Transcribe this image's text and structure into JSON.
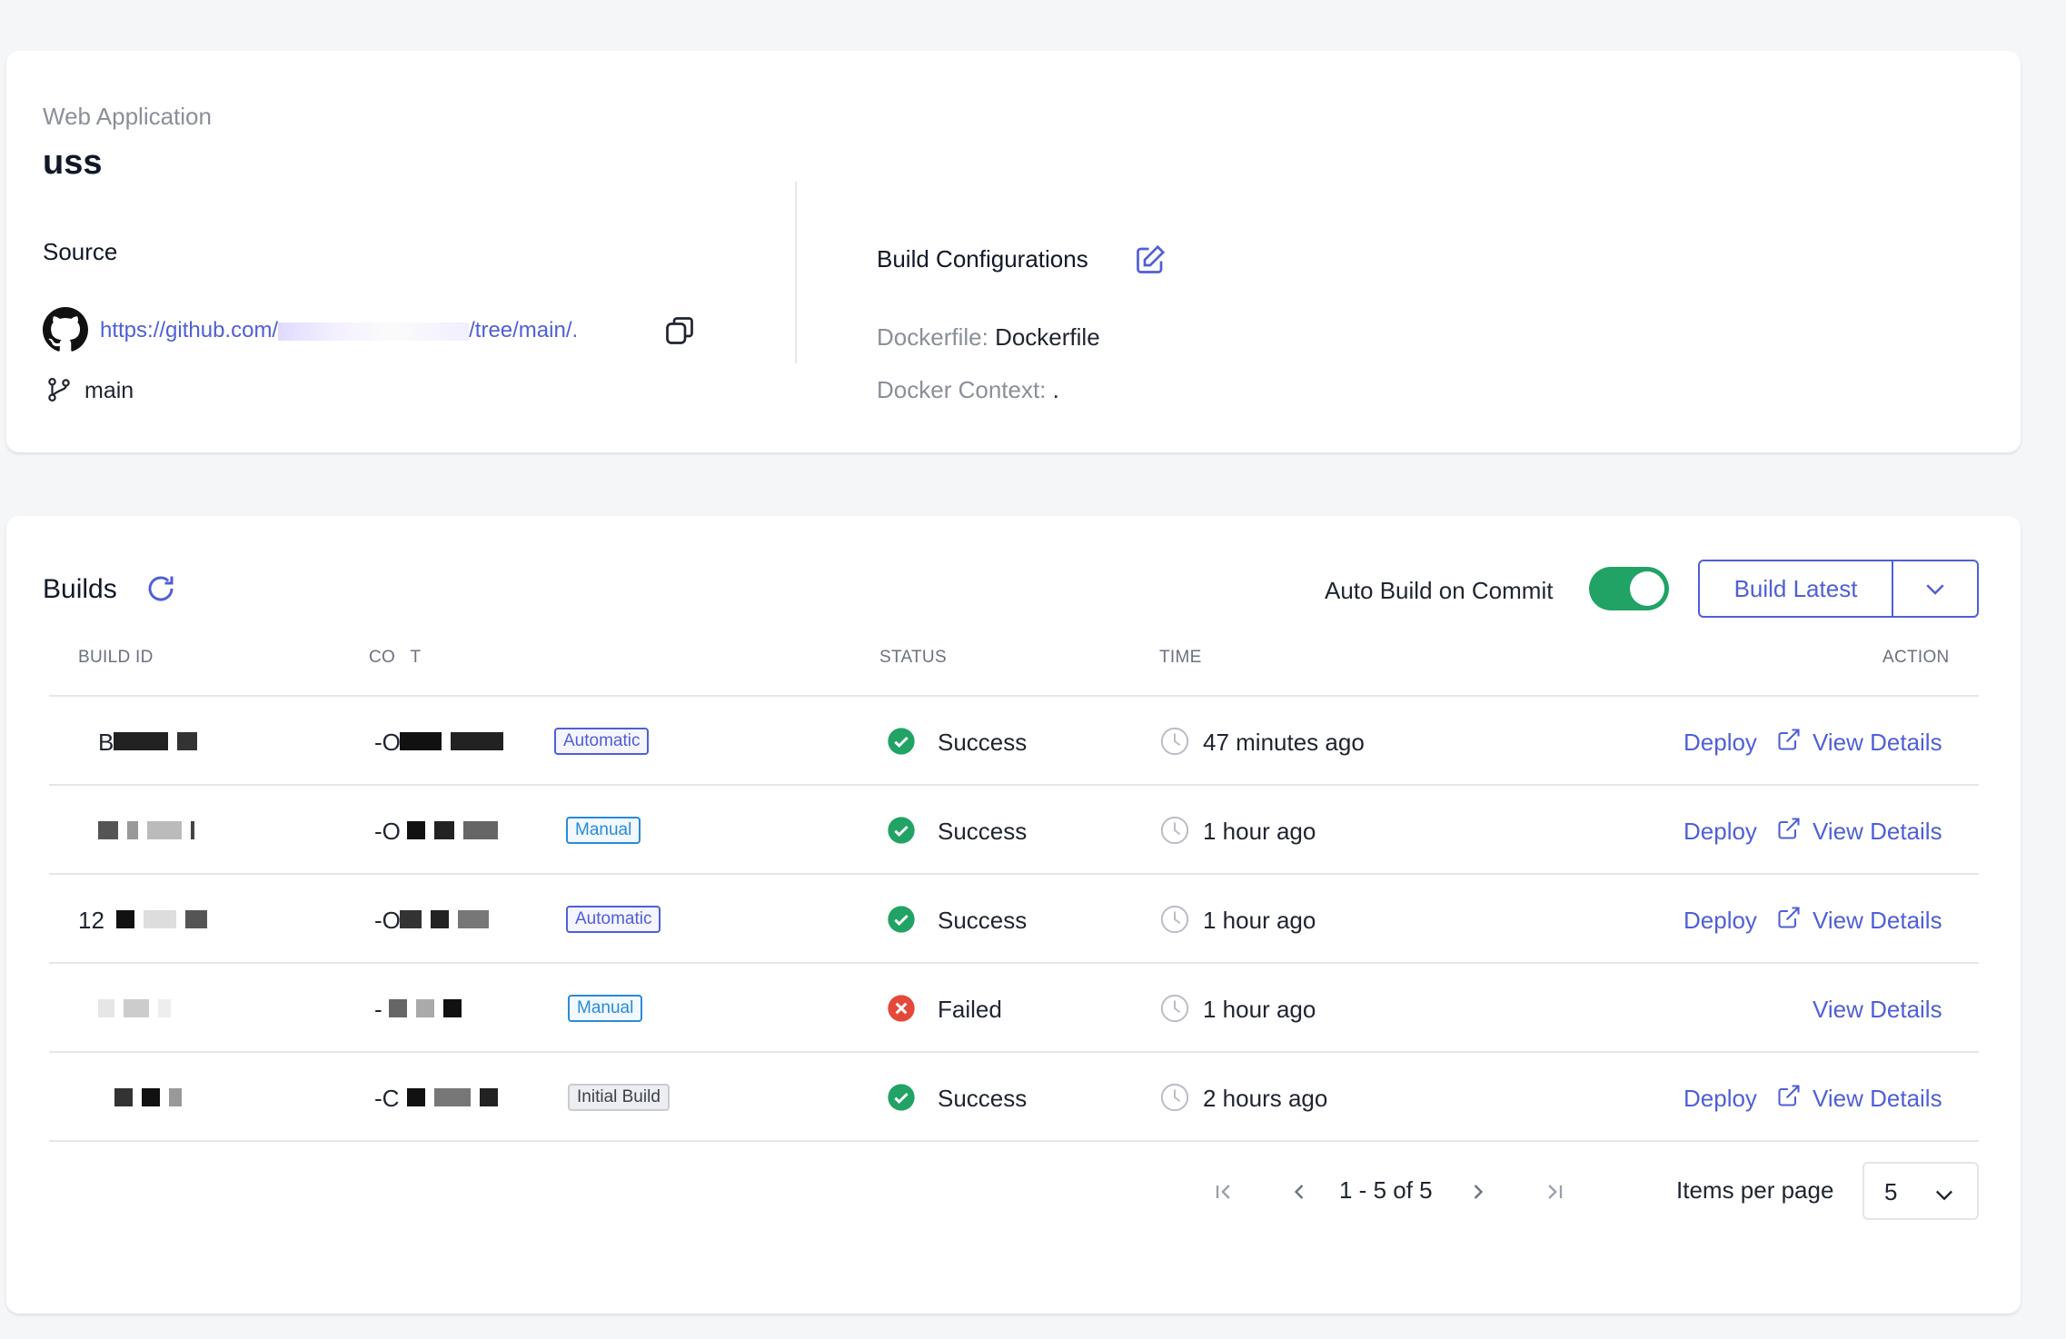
{
  "app": {
    "kind": "Web Application",
    "name": "uss"
  },
  "source": {
    "label": "Source",
    "repo_prefix": "https://github.com/",
    "repo_suffix": "/tree/main/.",
    "branch": "main"
  },
  "build_config": {
    "label": "Build Configurations",
    "dockerfile_key": "Dockerfile:",
    "dockerfile_value": "Dockerfile",
    "context_key": "Docker Context:",
    "context_value": "."
  },
  "builds": {
    "title": "Builds",
    "auto_build_label": "Auto Build on Commit",
    "auto_build_enabled": true,
    "build_latest_label": "Build Latest",
    "columns": {
      "build_id": "BUILD ID",
      "commit": "CO   T",
      "status": "STATUS",
      "time": "TIME",
      "action": "ACTION"
    },
    "rows": [
      {
        "build_id_visible": "B",
        "commit_visible": "-O",
        "trigger": "Automatic",
        "trigger_kind": "auto",
        "status": "Success",
        "time": "47 minutes ago",
        "deploy": "Deploy",
        "details": "View Details"
      },
      {
        "build_id_visible": "",
        "commit_visible": "-O",
        "trigger": "Manual",
        "trigger_kind": "manual",
        "status": "Success",
        "time": "1 hour ago",
        "deploy": "Deploy",
        "details": "View Details"
      },
      {
        "build_id_visible": "12",
        "commit_visible": "-O",
        "trigger": "Automatic",
        "trigger_kind": "auto",
        "status": "Success",
        "time": "1 hour ago",
        "deploy": "Deploy",
        "details": "View Details"
      },
      {
        "build_id_visible": "",
        "commit_visible": "-",
        "trigger": "Manual",
        "trigger_kind": "manual",
        "status": "Failed",
        "time": "1 hour ago",
        "deploy": "",
        "details": "View Details"
      },
      {
        "build_id_visible": "",
        "commit_visible": "-C",
        "trigger": "Initial Build",
        "trigger_kind": "initial",
        "status": "Success",
        "time": "2 hours ago",
        "deploy": "Deploy",
        "details": "View Details"
      }
    ],
    "pagination": {
      "range": "1 - 5 of 5",
      "items_per_page_label": "Items per page",
      "items_per_page": "5"
    }
  },
  "colors": {
    "accent": "#4f5fd6",
    "success": "#21a365",
    "failed": "#e5483b",
    "manual_tag": "#2a8bd6"
  },
  "icons": [
    "github-icon",
    "copy-icon",
    "branch-icon",
    "edit-icon",
    "refresh-icon",
    "chevron-down-icon",
    "check-circle-icon",
    "x-circle-icon",
    "clock-icon",
    "external-link-icon",
    "first-page-icon",
    "prev-page-icon",
    "next-page-icon",
    "last-page-icon"
  ]
}
